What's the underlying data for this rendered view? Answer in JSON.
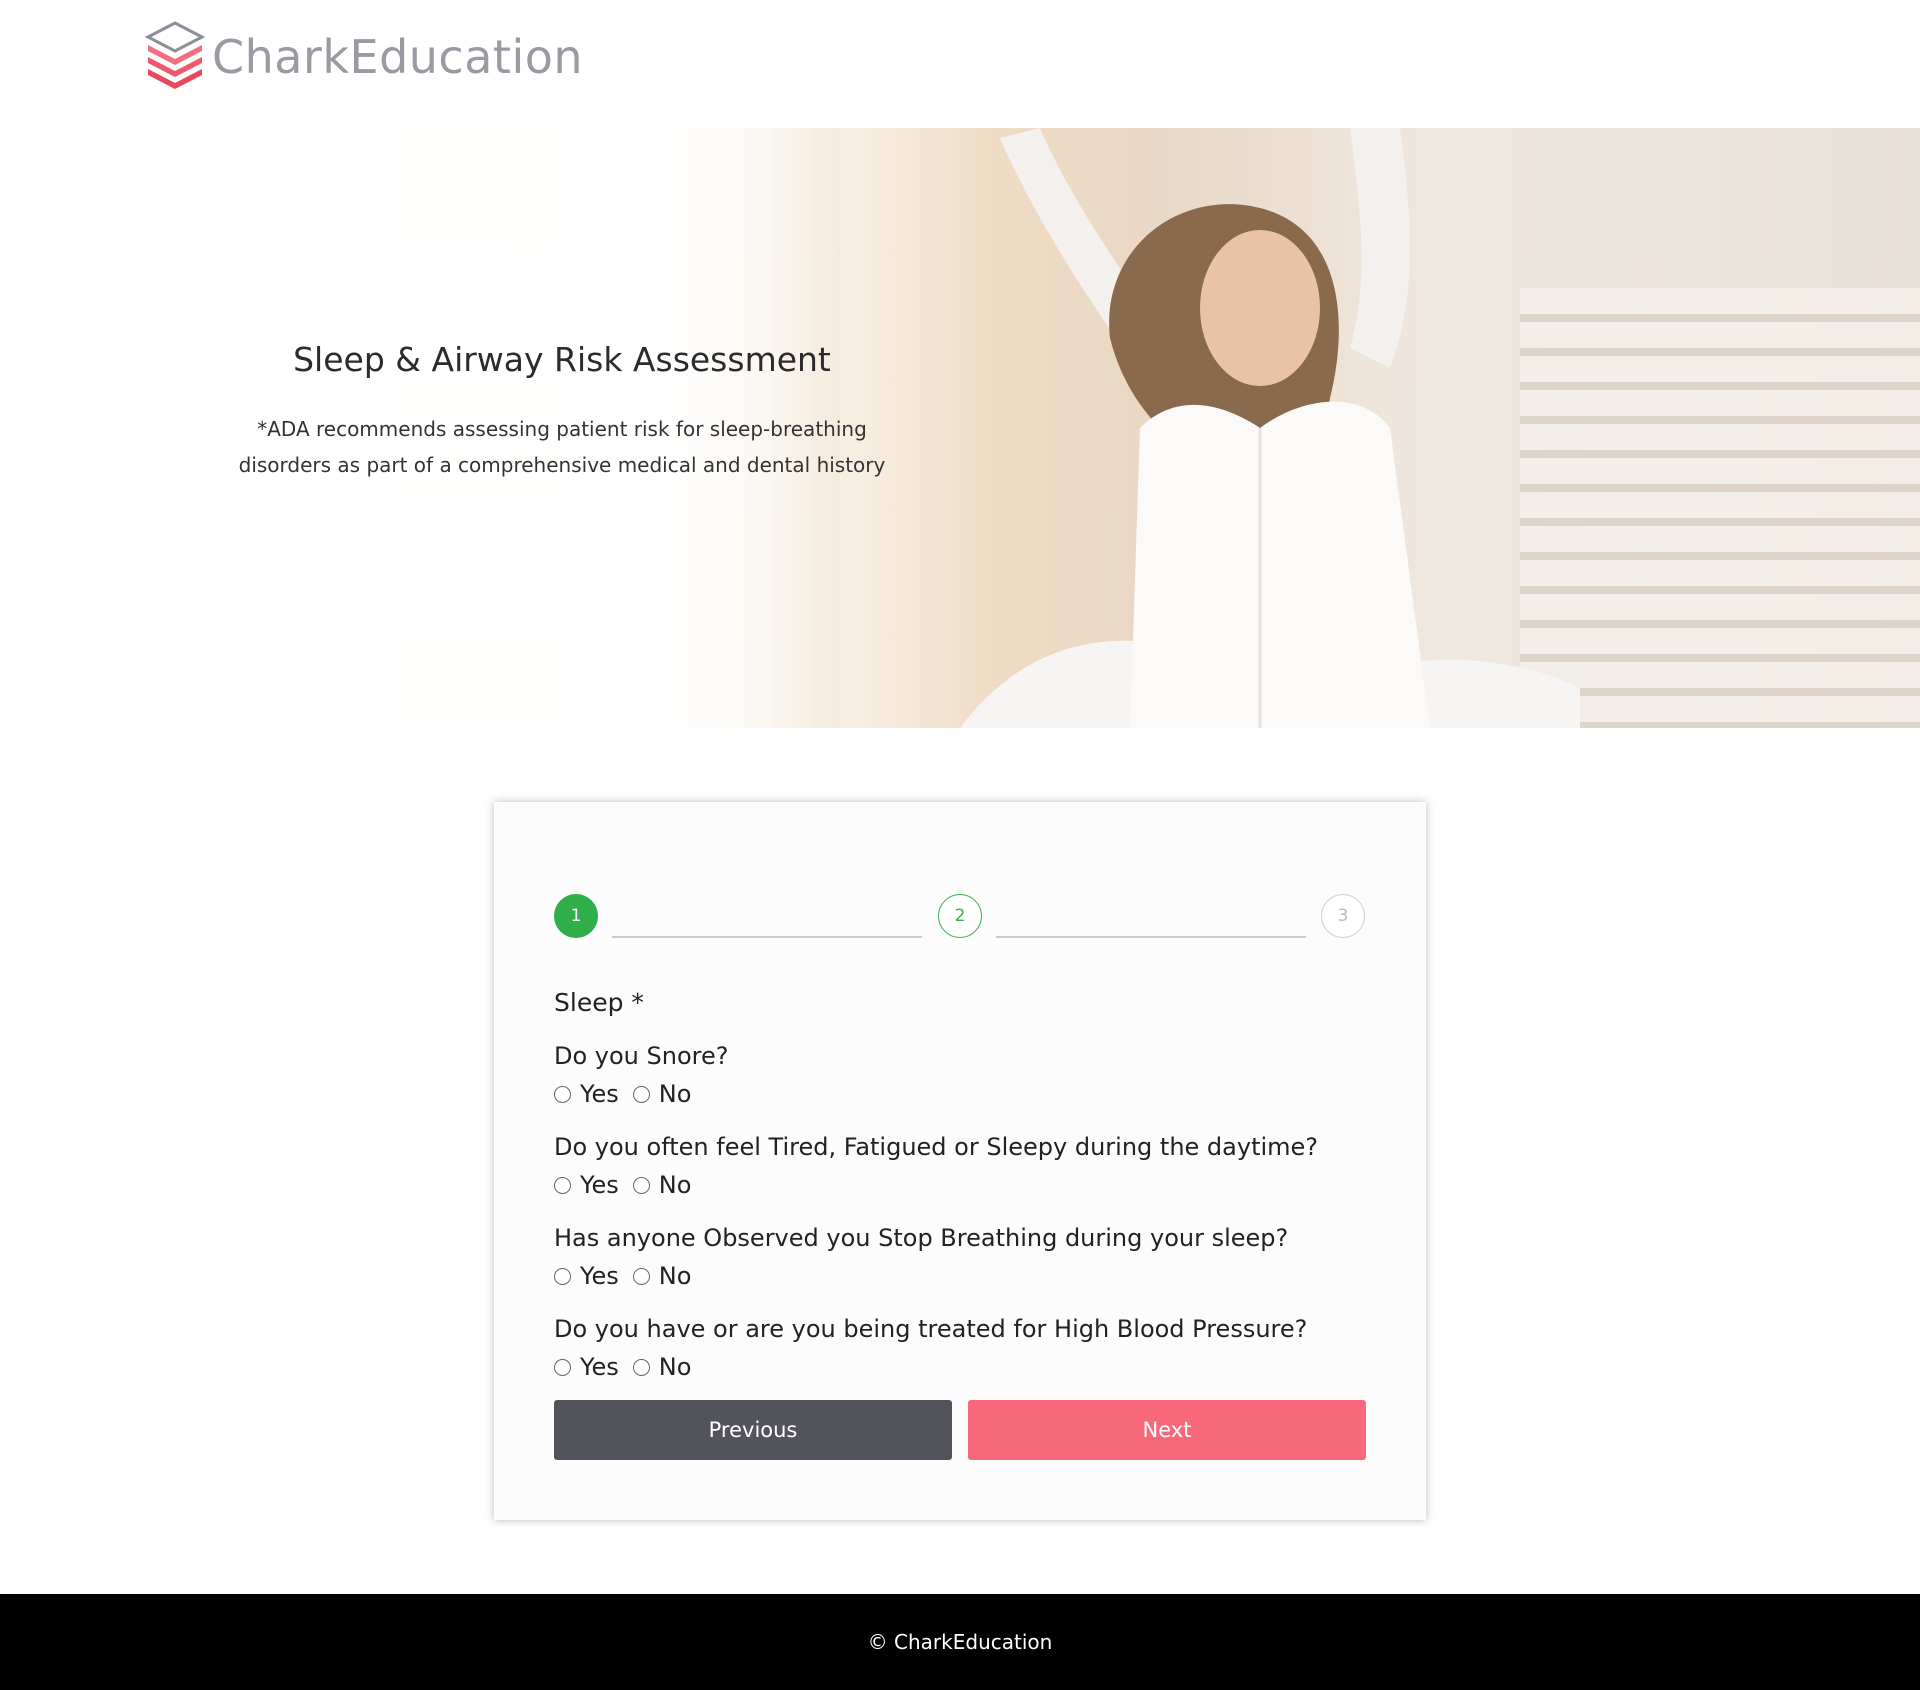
{
  "brand": {
    "name": "CharkEducation"
  },
  "hero": {
    "title": "Sleep & Airway Risk Assessment",
    "subtitle_line1": "*ADA recommends assessing patient risk for sleep-breathing",
    "subtitle_line2": "disorders as part of a comprehensive medical and dental history"
  },
  "stepper": {
    "steps": [
      "1",
      "2",
      "3"
    ],
    "current": 1
  },
  "form": {
    "section_label": "Sleep *",
    "questions": [
      {
        "text": "Do you Snore?",
        "options": [
          "Yes",
          "No"
        ]
      },
      {
        "text": "Do you often feel Tired, Fatigued or Sleepy during the daytime?",
        "options": [
          "Yes",
          "No"
        ]
      },
      {
        "text": "Has anyone Observed you Stop Breathing during your sleep?",
        "options": [
          "Yes",
          "No"
        ]
      },
      {
        "text": "Do you have or are you being treated for High Blood Pressure?",
        "options": [
          "Yes",
          "No"
        ]
      }
    ],
    "previous_label": "Previous",
    "next_label": "Next"
  },
  "footer": {
    "text": "© CharkEducation"
  },
  "colors": {
    "accent": "#f6687a",
    "step_active": "#2fae4a",
    "button_dark": "#53545b"
  }
}
